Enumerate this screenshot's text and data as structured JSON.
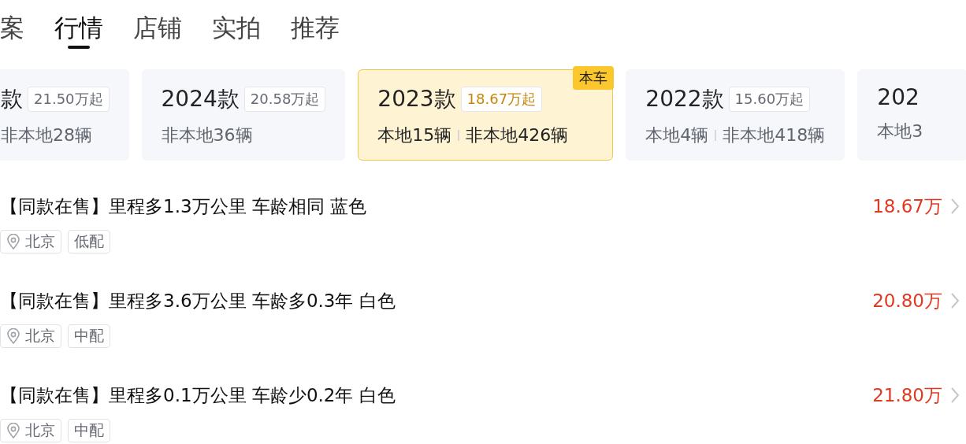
{
  "tabs": [
    {
      "label": "案",
      "selected": false
    },
    {
      "label": "行情",
      "selected": true
    },
    {
      "label": "店铺",
      "selected": false
    },
    {
      "label": "实拍",
      "selected": false
    },
    {
      "label": "推荐",
      "selected": false
    }
  ],
  "model_years": [
    {
      "year": "款",
      "price": "21.50万起",
      "nonlocal": "非本地28辆",
      "selected": false
    },
    {
      "year": "2024款",
      "price": "20.58万起",
      "nonlocal": "非本地36辆",
      "selected": false
    },
    {
      "year": "2023款",
      "price": "18.67万起",
      "local": "本地15辆",
      "nonlocal": "非本地426辆",
      "selected": true,
      "badge": "本车"
    },
    {
      "year": "2022款",
      "price": "15.60万起",
      "local": "本地4辆",
      "nonlocal": "非本地418辆",
      "selected": false
    },
    {
      "year": "202",
      "local": "本地3",
      "selected": false
    }
  ],
  "listings": [
    {
      "title": "【同款在售】里程多1.3万公里 车龄相同 蓝色",
      "city": "北京",
      "trim": "低配",
      "price": "18.67万"
    },
    {
      "title": "【同款在售】里程多3.6万公里 车龄多0.3年 白色",
      "city": "北京",
      "trim": "中配",
      "price": "20.80万"
    },
    {
      "title": "【同款在售】里程多0.1万公里 车龄少0.2年 白色",
      "city": "北京",
      "trim": "中配",
      "price": "21.80万"
    }
  ]
}
